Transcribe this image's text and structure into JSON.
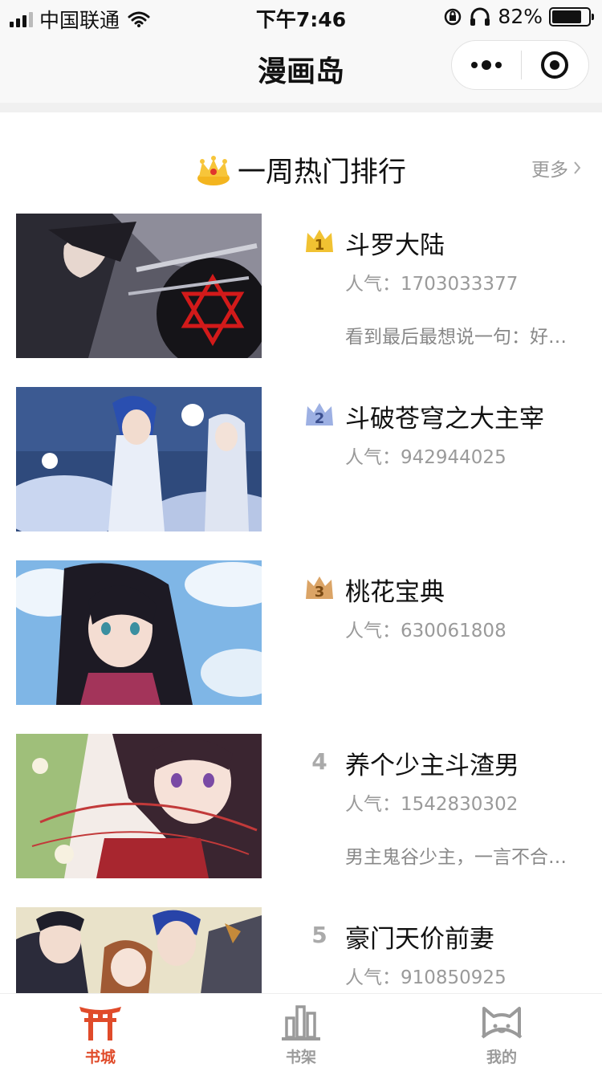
{
  "status_bar": {
    "carrier": "中国联通",
    "time": "下午7:46",
    "battery": "82%",
    "battery_level": 0.82
  },
  "nav": {
    "title": "漫画岛",
    "more_icon": "more-dots-icon",
    "close_icon": "target-close-icon"
  },
  "section": {
    "title": "一周热门排行",
    "more": "更多",
    "icon": "crown-icon"
  },
  "rankings": [
    {
      "rank": "1",
      "title": "斗罗大陆",
      "popularity": "人气：1703033377",
      "desc": "看到最后最想说一句：好…",
      "badge": "gold-crown-icon"
    },
    {
      "rank": "2",
      "title": "斗破苍穹之大主宰",
      "popularity": "人气：942944025",
      "desc": "",
      "badge": "silver-crown-icon"
    },
    {
      "rank": "3",
      "title": "桃花宝典",
      "popularity": "人气：630061808",
      "desc": "",
      "badge": "bronze-crown-icon"
    },
    {
      "rank": "4",
      "title": "养个少主斗渣男",
      "popularity": "人气：1542830302",
      "desc": "男主鬼谷少主，一言不合…",
      "badge": ""
    },
    {
      "rank": "5",
      "title": "豪门天价前妻",
      "popularity": "人气：910850925",
      "desc": "",
      "badge": ""
    }
  ],
  "tabs": [
    {
      "label": "书城",
      "icon": "torii-gate-icon",
      "active": true
    },
    {
      "label": "书架",
      "icon": "bookshelf-icon",
      "active": false
    },
    {
      "label": "我的",
      "icon": "cat-face-icon",
      "active": false
    }
  ],
  "colors": {
    "accent": "#e04b2a",
    "gold": "#f1c232",
    "silver": "#8fa3d9",
    "bronze": "#d7a05a",
    "inactive_tab": "#9a9a9a"
  }
}
